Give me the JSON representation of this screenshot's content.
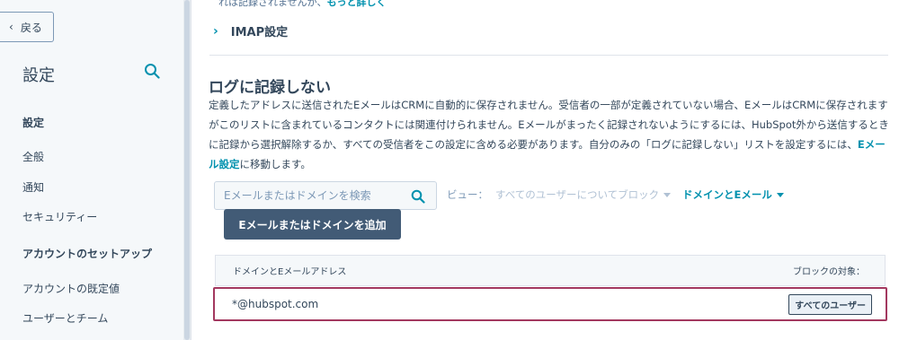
{
  "sidebar": {
    "back_label": "戻る",
    "title": "設定",
    "sections": [
      {
        "heading": "設定",
        "items": [
          "全般",
          "通知",
          "セキュリティー"
        ]
      },
      {
        "heading": "アカウントのセットアップ",
        "items": [
          "アカウントの既定値",
          "ユーザーとチーム"
        ]
      }
    ]
  },
  "main": {
    "top_cut_text": "れは記録されませんか、",
    "top_cut_link": "もっと詳しく",
    "imap_label": "IMAP設定",
    "section_title": "ログに記録しない",
    "description_parts": {
      "before_link": "定義したアドレスに送信されたEメールはCRMに自動的に保存されません。受信者の一部が定義されていない場合、EメールはCRMに保存されますがこのリストに含まれているコンタクトには関連付けられません。Eメールがまったく記録されないようにするには、HubSpot外から送信するときに記録から選択解除するか、すべての受信者をこの設定に含める必要があります。自分のみの「ログに記録しない」リストを設定するには、",
      "link": "Eメール設定",
      "after_link": "に移動します。"
    },
    "search": {
      "placeholder": "Eメールまたはドメインを検索"
    },
    "view": {
      "label": "ビュー：",
      "filter_blocked": "すべてのユーザーについてブロック",
      "filter_type": "ドメインとEメール"
    },
    "add_button": "Eメールまたはドメインを追加",
    "table": {
      "col_address": "ドメインとEメールアドレス",
      "col_target": "ブロックの対象：",
      "rows": [
        {
          "address": "*@hubspot.com",
          "target": "すべてのユーザー"
        }
      ]
    }
  },
  "colors": {
    "accent": "#0091ae",
    "text": "#33475b",
    "button": "#425b76",
    "highlight": "#a3385f"
  }
}
